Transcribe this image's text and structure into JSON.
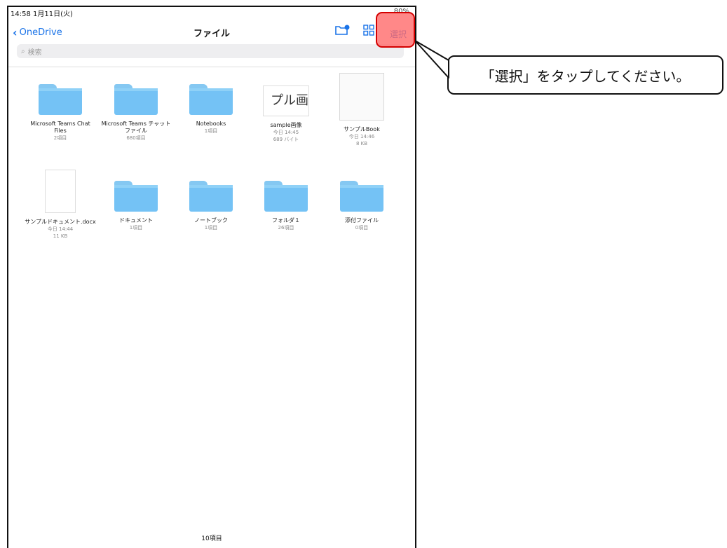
{
  "status": {
    "time": "14:58  1月11日(火)",
    "battery": "80%"
  },
  "nav": {
    "back_label": "OneDrive",
    "title": "ファイル",
    "select_label": "選択"
  },
  "search": {
    "placeholder": "検索"
  },
  "row1": [
    {
      "name": "Microsoft Teams Chat Files",
      "meta1": "2項目",
      "meta2": ""
    },
    {
      "name": "Microsoft Teams チャット ファイル",
      "meta1": "680項目",
      "meta2": ""
    },
    {
      "name": "Notebooks",
      "meta1": "1項目",
      "meta2": ""
    },
    {
      "name": "sample画像",
      "meta1": "今日 14:45",
      "meta2": "689 バイト",
      "thumb_text": "プル画"
    },
    {
      "name": "サンプルBook",
      "meta1": "今日 14:46",
      "meta2": "8 KB"
    }
  ],
  "row2": [
    {
      "name": "サンプルドキュメント.docx",
      "meta1": "今日 14:44",
      "meta2": "11 KB"
    },
    {
      "name": "ドキュメント",
      "meta1": "1項目",
      "meta2": ""
    },
    {
      "name": "ノートブック",
      "meta1": "1項目",
      "meta2": ""
    },
    {
      "name": "フォルダ１",
      "meta1": "26項目",
      "meta2": ""
    },
    {
      "name": "添付ファイル",
      "meta1": "0項目",
      "meta2": ""
    }
  ],
  "footer": {
    "count": "10項目"
  },
  "callout": {
    "text": "「選択」をタップしてください。"
  },
  "colors": {
    "accent": "#1a73e8",
    "folder": "#74c2f5",
    "highlight": "#ff6666"
  }
}
